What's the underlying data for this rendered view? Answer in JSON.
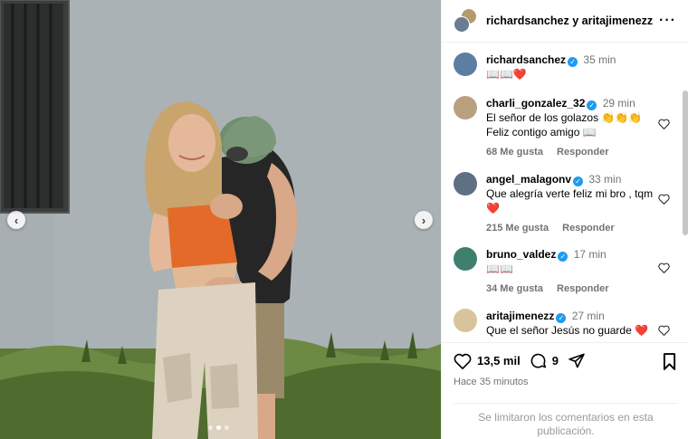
{
  "post": {
    "prev_icon": "chevron-left-icon",
    "next_icon": "chevron-right-icon",
    "carousel_pages": 3,
    "carousel_active_index": 1
  },
  "header": {
    "user1": "richardsanchez",
    "joiner": "y",
    "user2": "aritajimenezz",
    "more_icon": "more-horizontal-icon"
  },
  "caption": {
    "user": "richardsanchez",
    "time": "35 min",
    "text": "📖📖❤️"
  },
  "comments": [
    {
      "user": "charli_gonzalez_32",
      "time": "29 min",
      "text": "El señor de los golazos 👏👏👏 Feliz contigo amigo 📖",
      "likes": "68 Me gusta",
      "reply": "Responder"
    },
    {
      "user": "angel_malagonv",
      "time": "33 min",
      "text": "Que alegría verte feliz mi bro , tqm ❤️",
      "likes": "215 Me gusta",
      "reply": "Responder"
    },
    {
      "user": "bruno_valdez",
      "time": "17 min",
      "text": "📖📖",
      "likes": "34 Me gusta",
      "reply": "Responder"
    },
    {
      "user": "aritajimenezz",
      "time": "27 min",
      "text": "Que el señor Jesús no guarde ❤️"
    }
  ],
  "actions": {
    "like_count": "13,5 mil",
    "comment_count": "9",
    "posted_ago": "Hace 35 minutos",
    "limited_notice": "Se limitaron los comentarios en esta publicación."
  },
  "colors": {
    "verified": "#1d9bf0",
    "secondary_text": "#737373",
    "divider": "#efefef"
  }
}
